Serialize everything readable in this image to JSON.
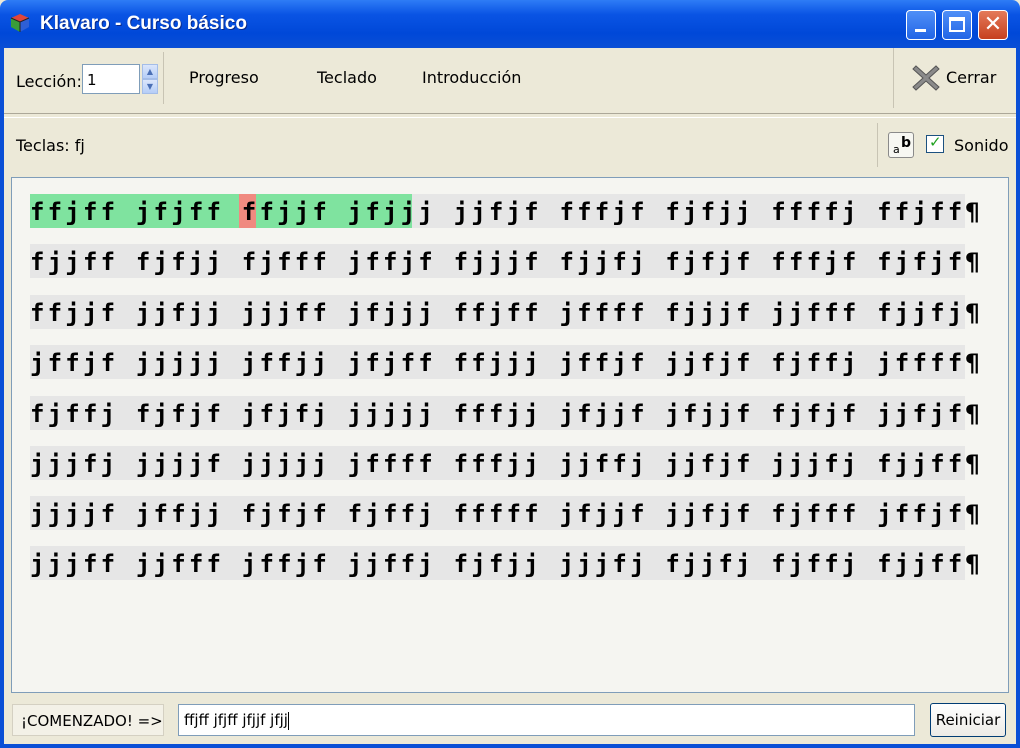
{
  "window": {
    "title": "Klavaro - Curso básico",
    "icon": "klavaro-cube-icon"
  },
  "toolbar": {
    "lesson_label": "Lección:",
    "lesson_value": "1",
    "progress_label": "Progreso",
    "keyboard_label": "Teclado",
    "intro_label": "Introducción",
    "close_label": "Cerrar"
  },
  "keys_bar": {
    "keys_label": "Teclas: fj",
    "sound_label": "Sonido",
    "sound_checked": true
  },
  "exercise": {
    "lines": [
      "ffjff jfjff ffjjf jfjjj jjfjf fffjf fjfjj ffffj ffjff¶",
      "fjjff fjfjj fjfff jffjf fjjjf fjjfj fjfjf fffjf fjfjf¶",
      "ffjjf jjfjj jjjff jfjjj ffjff jffff fjjjf jjfff fjjfj¶",
      "jffjf jjjjj jffjj jfjff ffjjj jffjf jjfjf fjffj jffff¶",
      "fjffj fjfjf jfjfj jjjjj fffjj jfjjf jfjjf fjfjf jjfjf¶",
      "jjjfj jjjjf jjjjj jffff fffjj jjffj jjfjf jjjfj fjjff¶",
      "jjjjf jffjj fjfjf fjffj fffff jfjjf jjfjf fjfff jffjf¶",
      "jjjff jjfff jffjf jjffj fjfjj jjjfj fjjfj fjffj fjjff¶"
    ],
    "typed_correct_chars": 17,
    "error_char_index": 12,
    "highlight_colors": {
      "correct": "#7fe39f",
      "error": "#f08a80"
    }
  },
  "status": {
    "state_label": "¡COMENZADO! =>",
    "typed_text": "ffjff jfjff jfjjf jfjj",
    "restart_label": "Reiniciar"
  }
}
